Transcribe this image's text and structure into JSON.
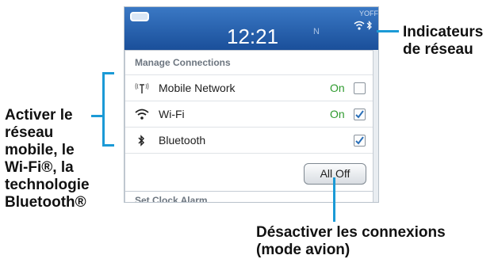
{
  "status_bar": {
    "time": "12:21",
    "network_letter": "N",
    "signal_state": "OFF",
    "icons": [
      "battery-icon",
      "signal-off-icon",
      "wifi-icon",
      "bluetooth-icon"
    ]
  },
  "panel": {
    "title": "Manage Connections",
    "rows": [
      {
        "label": "Mobile Network",
        "state": "On",
        "checked": false,
        "icon": "mobile-antenna-icon"
      },
      {
        "label": "Wi-Fi",
        "state": "On",
        "checked": true,
        "icon": "wifi-icon"
      },
      {
        "label": "Bluetooth",
        "state": "",
        "checked": true,
        "icon": "bluetooth-icon"
      }
    ],
    "all_off_label": "All Off",
    "next_section_title": "Set Clock Alarm"
  },
  "callouts": {
    "network_indicators": [
      "Indicateurs",
      "de réseau"
    ],
    "enable_networks": [
      "Activer le",
      "réseau",
      "mobile, le",
      "Wi-Fi®, la",
      "technologie",
      "Bluetooth®"
    ],
    "disable_connections": [
      "Désactiver les connexions",
      "(mode avion)"
    ]
  },
  "colors": {
    "status_bar": "#1a4f9a",
    "accent_line": "#1b9ad6",
    "on_state": "#2e9a2e",
    "checkmark": "#2a6fb8"
  }
}
